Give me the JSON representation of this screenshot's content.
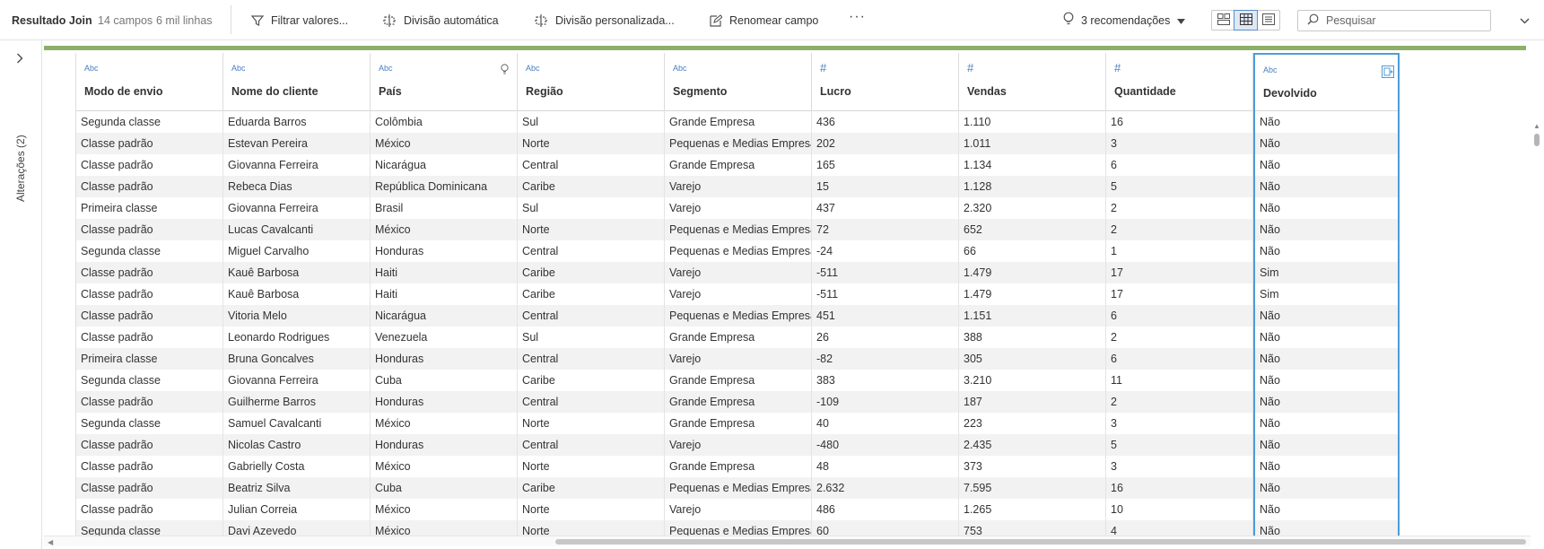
{
  "toolbar": {
    "title": "Resultado Join",
    "fields_count": "14 campos",
    "rows_count": "6 mil linhas",
    "filter_label": "Filtrar valores...",
    "auto_split_label": "Divisão automática",
    "custom_split_label": "Divisão personalizada...",
    "rename_label": "Renomear campo",
    "more_label": "···",
    "recommendations_label": "3 recomendações",
    "search_placeholder": "Pesquisar"
  },
  "rail": {
    "changes_label": "Alterações (2)"
  },
  "colors": {
    "accent_green": "#8db068",
    "selected_blue": "#4d9bd8",
    "type_blue": "#4a7dbf"
  },
  "columns": [
    {
      "type": "Abc",
      "name": "Modo de envio"
    },
    {
      "type": "Abc",
      "name": "Nome do cliente"
    },
    {
      "type": "Abc",
      "name": "País"
    },
    {
      "type": "Abc",
      "name": "Região"
    },
    {
      "type": "Abc",
      "name": "Segmento"
    },
    {
      "type": "#",
      "name": "Lucro"
    },
    {
      "type": "#",
      "name": "Vendas"
    },
    {
      "type": "#",
      "name": "Quantidade"
    },
    {
      "type": "Abc",
      "name": "Devolvido"
    }
  ],
  "rows": [
    [
      "Segunda classe",
      "Eduarda Barros",
      "Colômbia",
      "Sul",
      "Grande Empresa",
      "436",
      "1.110",
      "16",
      "Não"
    ],
    [
      "Classe padrão",
      "Estevan Pereira",
      "México",
      "Norte",
      "Pequenas e Medias Empresas",
      "202",
      "1.011",
      "3",
      "Não"
    ],
    [
      "Classe padrão",
      "Giovanna Ferreira",
      "Nicarágua",
      "Central",
      "Grande Empresa",
      "165",
      "1.134",
      "6",
      "Não"
    ],
    [
      "Classe padrão",
      "Rebeca Dias",
      "República Dominicana",
      "Caribe",
      "Varejo",
      "15",
      "1.128",
      "5",
      "Não"
    ],
    [
      "Primeira classe",
      "Giovanna Ferreira",
      "Brasil",
      "Sul",
      "Varejo",
      "437",
      "2.320",
      "2",
      "Não"
    ],
    [
      "Classe padrão",
      "Lucas Cavalcanti",
      "México",
      "Norte",
      "Pequenas e Medias Empresas",
      "72",
      "652",
      "2",
      "Não"
    ],
    [
      "Segunda classe",
      "Miguel Carvalho",
      "Honduras",
      "Central",
      "Pequenas e Medias Empresas",
      "-24",
      "66",
      "1",
      "Não"
    ],
    [
      "Classe padrão",
      "Kauê Barbosa",
      "Haiti",
      "Caribe",
      "Varejo",
      "-511",
      "1.479",
      "17",
      "Sim"
    ],
    [
      "Classe padrão",
      "Kauê Barbosa",
      "Haiti",
      "Caribe",
      "Varejo",
      "-511",
      "1.479",
      "17",
      "Sim"
    ],
    [
      "Classe padrão",
      "Vitoria Melo",
      "Nicarágua",
      "Central",
      "Pequenas e Medias Empresas",
      "451",
      "1.151",
      "6",
      "Não"
    ],
    [
      "Classe padrão",
      "Leonardo Rodrigues",
      "Venezuela",
      "Sul",
      "Grande Empresa",
      "26",
      "388",
      "2",
      "Não"
    ],
    [
      "Primeira classe",
      "Bruna Goncalves",
      "Honduras",
      "Central",
      "Varejo",
      "-82",
      "305",
      "6",
      "Não"
    ],
    [
      "Segunda classe",
      "Giovanna Ferreira",
      "Cuba",
      "Caribe",
      "Grande Empresa",
      "383",
      "3.210",
      "11",
      "Não"
    ],
    [
      "Classe padrão",
      "Guilherme Barros",
      "Honduras",
      "Central",
      "Grande Empresa",
      "-109",
      "187",
      "2",
      "Não"
    ],
    [
      "Segunda classe",
      "Samuel Cavalcanti",
      "México",
      "Norte",
      "Grande Empresa",
      "40",
      "223",
      "3",
      "Não"
    ],
    [
      "Classe padrão",
      "Nicolas Castro",
      "Honduras",
      "Central",
      "Varejo",
      "-480",
      "2.435",
      "5",
      "Não"
    ],
    [
      "Classe padrão",
      "Gabrielly Costa",
      "México",
      "Norte",
      "Grande Empresa",
      "48",
      "373",
      "3",
      "Não"
    ],
    [
      "Classe padrão",
      "Beatriz Silva",
      "Cuba",
      "Caribe",
      "Pequenas e Medias Empresas",
      "2.632",
      "7.595",
      "16",
      "Não"
    ],
    [
      "Classe padrão",
      "Julian Correia",
      "México",
      "Norte",
      "Varejo",
      "486",
      "1.265",
      "10",
      "Não"
    ],
    [
      "Segunda classe",
      "Davi Azevedo",
      "México",
      "Norte",
      "Pequenas e Medias Empresas",
      "60",
      "753",
      "4",
      "Não"
    ]
  ]
}
